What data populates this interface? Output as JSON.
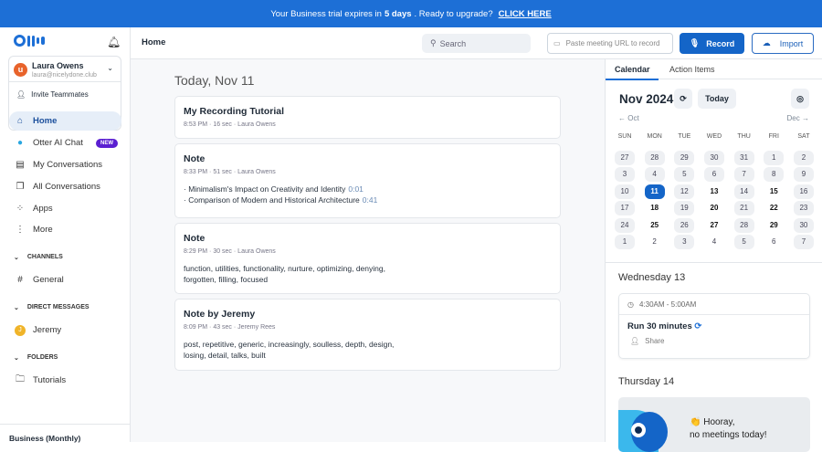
{
  "banner": {
    "pre": "Your Business trial expires in",
    "days": "5 days",
    "mid": ". Ready to upgrade?",
    "cta": "CLICK HERE"
  },
  "user": {
    "initial": "u",
    "name": "Laura Owens",
    "email": "laura@nicelydone.club",
    "invite": "Invite Teammates"
  },
  "nav": [
    {
      "label": "Home",
      "icon": "home-icon"
    },
    {
      "label": "Otter AI Chat",
      "icon": "otter-icon",
      "badge": "NEW"
    },
    {
      "label": "My Conversations",
      "icon": "document-icon"
    },
    {
      "label": "All Conversations",
      "icon": "documents-icon"
    },
    {
      "label": "Apps",
      "icon": "apps-icon"
    },
    {
      "label": "More",
      "icon": "more-icon"
    }
  ],
  "sections": {
    "channels": "CHANNELS",
    "general": "General",
    "dm": "DIRECT MESSAGES",
    "jeremy": "Jeremy",
    "jeremy_initial": "J",
    "folders": "FOLDERS",
    "tutorials": "Tutorials"
  },
  "plan": "Business (Monthly)",
  "topbar": {
    "title": "Home",
    "search_placeholder": "Search",
    "url_placeholder": "Paste meeting URL to record",
    "record": "Record",
    "import": "Import"
  },
  "main": {
    "date": "Today, Nov 11",
    "cards": [
      {
        "title": "My Recording Tutorial",
        "time": "8:53 PM",
        "dur": "16 sec",
        "owner": "Laura Owens"
      },
      {
        "title": "Note",
        "time": "8:33 PM",
        "dur": "51 sec",
        "owner": "Laura Owens",
        "bullets": [
          {
            "text": "Minimalism's Impact on Creativity and Identity",
            "t": "0:01"
          },
          {
            "text": "Comparison of Modern and Historical Architecture",
            "t": "0:41"
          }
        ]
      },
      {
        "title": "Note",
        "time": "8:29 PM",
        "dur": "30 sec",
        "owner": "Laura Owens",
        "keywords": "function, utilities, functionality, nurture, optimizing, denying, forgotten, filling, focused"
      },
      {
        "title": "Note by Jeremy",
        "time": "8:09 PM",
        "dur": "43 sec",
        "owner": "Jeremy Rees",
        "keywords": "post, repetitive, generic, increasingly, soulless, depth, design, losing, detail, talks, built"
      }
    ]
  },
  "right": {
    "tabs": [
      "Calendar",
      "Action Items"
    ],
    "month": "Nov 2024",
    "today": "Today",
    "prev": "Oct",
    "next": "Dec",
    "weekdays": [
      "SUN",
      "MON",
      "TUE",
      "WED",
      "THU",
      "FRI",
      "SAT"
    ],
    "weeks": [
      [
        [
          "27",
          "o"
        ],
        [
          "28",
          "o"
        ],
        [
          "29",
          "o"
        ],
        [
          "30",
          "o"
        ],
        [
          "31",
          "o"
        ],
        [
          "1",
          "o"
        ],
        [
          "2",
          "o"
        ]
      ],
      [
        [
          "3",
          "o"
        ],
        [
          "4",
          "o"
        ],
        [
          "5",
          "o"
        ],
        [
          "6",
          "o"
        ],
        [
          "7",
          "o"
        ],
        [
          "8",
          "o"
        ],
        [
          "9",
          "o"
        ]
      ],
      [
        [
          "10",
          "o"
        ],
        [
          "11",
          "s"
        ],
        [
          "12",
          "o"
        ],
        [
          "13",
          "b"
        ],
        [
          "14",
          "o"
        ],
        [
          "15",
          "b"
        ],
        [
          "16",
          "o"
        ]
      ],
      [
        [
          "17",
          "o"
        ],
        [
          "18",
          "b"
        ],
        [
          "19",
          "o"
        ],
        [
          "20",
          "b"
        ],
        [
          "21",
          "o"
        ],
        [
          "22",
          "b"
        ],
        [
          "23",
          "o"
        ]
      ],
      [
        [
          "24",
          "o"
        ],
        [
          "25",
          "b"
        ],
        [
          "26",
          "o"
        ],
        [
          "27",
          "b"
        ],
        [
          "28",
          "o"
        ],
        [
          "29",
          "b"
        ],
        [
          "30",
          "o"
        ]
      ],
      [
        [
          "1",
          "o"
        ],
        [
          "2",
          "p"
        ],
        [
          "3",
          "o"
        ],
        [
          "4",
          "p"
        ],
        [
          "5",
          "o"
        ],
        [
          "6",
          "p"
        ],
        [
          "7",
          "o"
        ]
      ]
    ],
    "day1": "Wednesday 13",
    "event": {
      "time": "4:30AM - 5:00AM",
      "name": "Run 30 minutes",
      "share": "Share"
    },
    "day2": "Thursday 14",
    "hooray1": "Hooray,",
    "hooray2": "no meetings today!"
  }
}
